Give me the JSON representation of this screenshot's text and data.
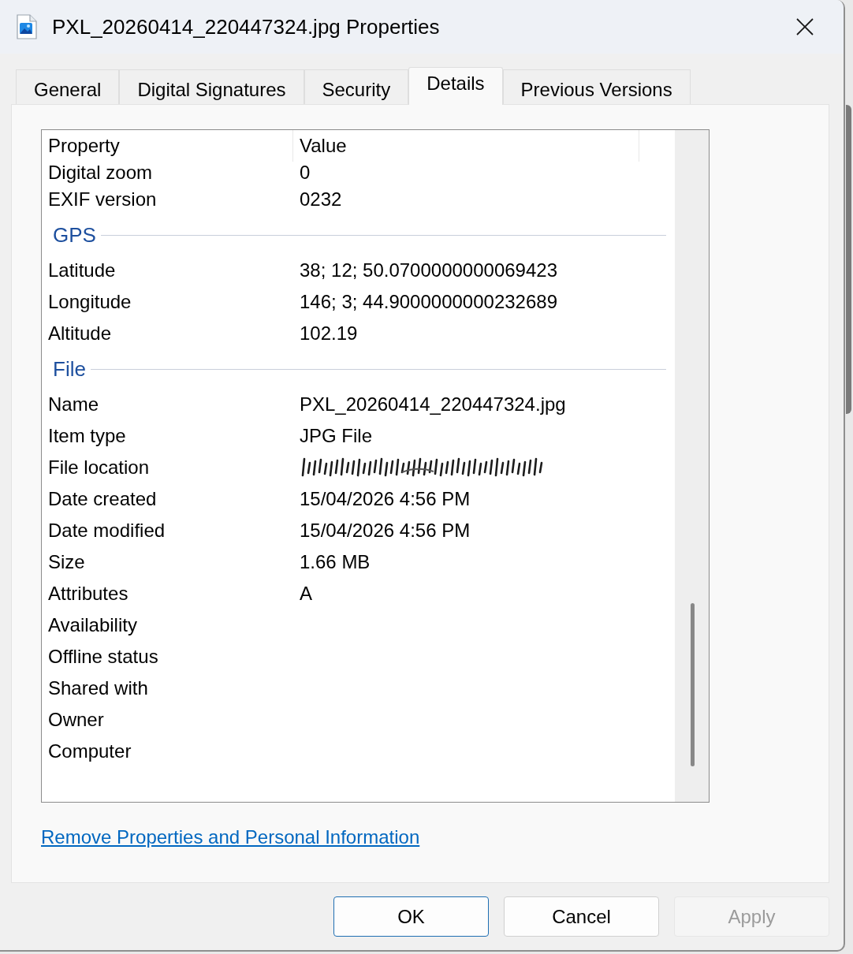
{
  "window": {
    "title": "PXL_20260414_220447324.jpg Properties"
  },
  "tabs": [
    {
      "label": "General",
      "selected": false
    },
    {
      "label": "Digital Signatures",
      "selected": false
    },
    {
      "label": "Security",
      "selected": false
    },
    {
      "label": "Details",
      "selected": true
    },
    {
      "label": "Previous Versions",
      "selected": false
    }
  ],
  "details": {
    "columns": [
      "Property",
      "Value"
    ],
    "rows": [
      {
        "kind": "row",
        "property": "Digital zoom",
        "value": "0",
        "redacted": false
      },
      {
        "kind": "row",
        "property": "EXIF version",
        "value": "0232",
        "redacted": false
      },
      {
        "kind": "section",
        "title": "GPS"
      },
      {
        "kind": "row",
        "property": "Latitude",
        "value": "38; 12; 50.0700000000069423",
        "redacted": false
      },
      {
        "kind": "row",
        "property": "Longitude",
        "value": "146; 3; 44.9000000000232689",
        "redacted": false
      },
      {
        "kind": "row",
        "property": "Altitude",
        "value": "102.19",
        "redacted": false
      },
      {
        "kind": "section",
        "title": "File"
      },
      {
        "kind": "row",
        "property": "Name",
        "value": "PXL_20260414_220447324.jpg",
        "redacted": false
      },
      {
        "kind": "row",
        "property": "Item type",
        "value": "JPG File",
        "redacted": false
      },
      {
        "kind": "row",
        "property": "File location",
        "redacted": true
      },
      {
        "kind": "row",
        "property": "Date created",
        "value": "15/04/2026 4:56 PM",
        "redacted": false
      },
      {
        "kind": "row",
        "property": "Date modified",
        "value": "15/04/2026 4:56 PM",
        "redacted": false
      },
      {
        "kind": "row",
        "property": "Size",
        "value": "1.66 MB",
        "redacted": false
      },
      {
        "kind": "row",
        "property": "Attributes",
        "value": "A",
        "redacted": false
      },
      {
        "kind": "row",
        "property": "Availability",
        "redacted": false
      },
      {
        "kind": "row",
        "property": "Offline status",
        "redacted": false
      },
      {
        "kind": "row",
        "property": "Shared with",
        "redacted": false
      },
      {
        "kind": "row",
        "property": "Owner",
        "redacted": false
      },
      {
        "kind": "row",
        "property": "Computer",
        "redacted": false
      }
    ]
  },
  "link": "Remove Properties and Personal Information",
  "buttons": [
    {
      "label": "OK",
      "default": true,
      "disabled": false
    },
    {
      "label": "Cancel",
      "default": false,
      "disabled": false
    },
    {
      "label": "Apply",
      "default": false,
      "disabled": true
    }
  ]
}
